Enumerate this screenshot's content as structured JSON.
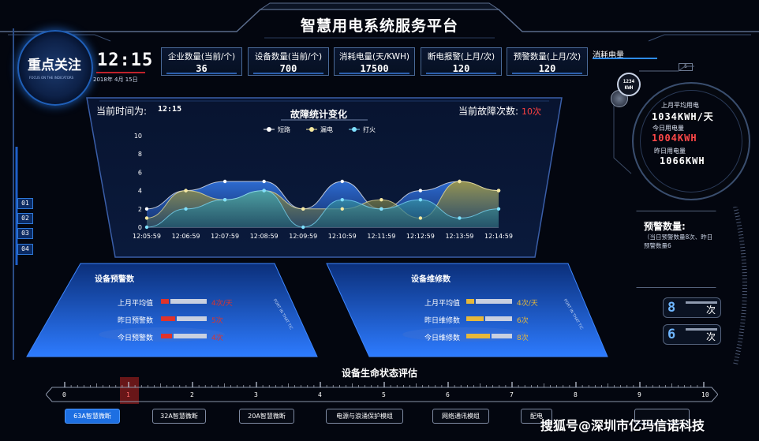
{
  "header": {
    "title": "智慧用电系统服务平台"
  },
  "focus": {
    "title": "重点关注",
    "subtitle": "FOCUS ON THE INDICATORS",
    "clock": "12:15",
    "date": "2018年 4月 15日"
  },
  "stats": [
    {
      "label": "企业数量(当前/个)",
      "value": "36"
    },
    {
      "label": "设备数量(当前/个)",
      "value": "700"
    },
    {
      "label": "消耗电量(天/KWH)",
      "value": "17500"
    },
    {
      "label": "断电报警(上月/次)",
      "value": "120"
    },
    {
      "label": "预警数量(上月/次)",
      "value": "120"
    }
  ],
  "consumption": {
    "tab": "消耗电量",
    "badge_top": "5",
    "kwh_badge": {
      "line1": "1234",
      "line2": "KWH"
    },
    "items": [
      {
        "label": "上月平均用电",
        "value": "1034KWH/天"
      },
      {
        "label": "今日用电量",
        "value": "1004KWH"
      },
      {
        "label": "昨日用电量",
        "value": "1066KWH"
      }
    ]
  },
  "fault_panel": {
    "current_time_label": "当前时间为:",
    "current_time": "12:15",
    "fault_count_label": "当前故障次数:",
    "fault_count": "10次",
    "colors": {
      "short": "#ffffff",
      "leak": "#f6e9a0",
      "fire": "#7fe0ff"
    }
  },
  "chart_data": {
    "type": "area",
    "title": "故障统计变化",
    "x": [
      "12:05:59",
      "12:06:59",
      "12:07:59",
      "12:08:59",
      "12:09:59",
      "12:10:59",
      "12:11:59",
      "12:12:59",
      "12:13:59",
      "12:14:59"
    ],
    "ylim": [
      0,
      10
    ],
    "yticks": [
      0,
      2,
      4,
      6,
      8,
      10
    ],
    "series": [
      {
        "name": "短路",
        "values": [
          2,
          4,
          5,
          5,
          2,
          5,
          2,
          4,
          5,
          4
        ]
      },
      {
        "name": "漏电",
        "values": [
          1,
          4,
          3,
          4,
          2,
          2,
          3,
          1,
          5,
          4
        ]
      },
      {
        "name": "打火",
        "values": [
          0,
          2,
          3,
          4,
          0,
          3,
          2,
          3,
          1,
          2
        ]
      }
    ]
  },
  "side_tabs": [
    "01",
    "02",
    "03",
    "04"
  ],
  "forecast": {
    "title": "预警数量:",
    "desc": "（当日预警数量8次、昨日预警数量6"
  },
  "counters": [
    {
      "value": "8",
      "unit": "次"
    },
    {
      "value": "6",
      "unit": "次"
    }
  ],
  "warning_panel": {
    "title": "设备预警数",
    "side_text": "PORT IN THAT TIC",
    "rows": [
      {
        "label": "上月平均值",
        "value": "4次/天"
      },
      {
        "label": "昨日预警数",
        "value": "5次"
      },
      {
        "label": "今日预警数",
        "value": "4次"
      }
    ],
    "color": "#e0332b"
  },
  "repair_panel": {
    "title": "设备维修数",
    "side_text": "PORT IN THAT TIC",
    "rows": [
      {
        "label": "上月平均值",
        "value": "4次/天"
      },
      {
        "label": "昨日维修数",
        "value": "6次"
      },
      {
        "label": "今日维修数",
        "value": "8次"
      }
    ],
    "color": "#e7b83a"
  },
  "lifecycle": {
    "title": "设备生命状态评估",
    "ticks": [
      "0",
      "1",
      "2",
      "3",
      "4",
      "5",
      "6",
      "7",
      "8",
      "9",
      "10"
    ],
    "current": 1
  },
  "modules": [
    {
      "label": "63A智慧微断",
      "active": true
    },
    {
      "label": "32A智慧微断",
      "active": false
    },
    {
      "label": "20A智慧微断",
      "active": false
    },
    {
      "label": "电源与浪涌保护模组",
      "active": false
    },
    {
      "label": "网络通讯模组",
      "active": false
    },
    {
      "label": "配电",
      "active": false
    },
    {
      "label": "",
      "active": false
    }
  ],
  "watermark": "搜狐号@深圳市亿玛信诺科技"
}
